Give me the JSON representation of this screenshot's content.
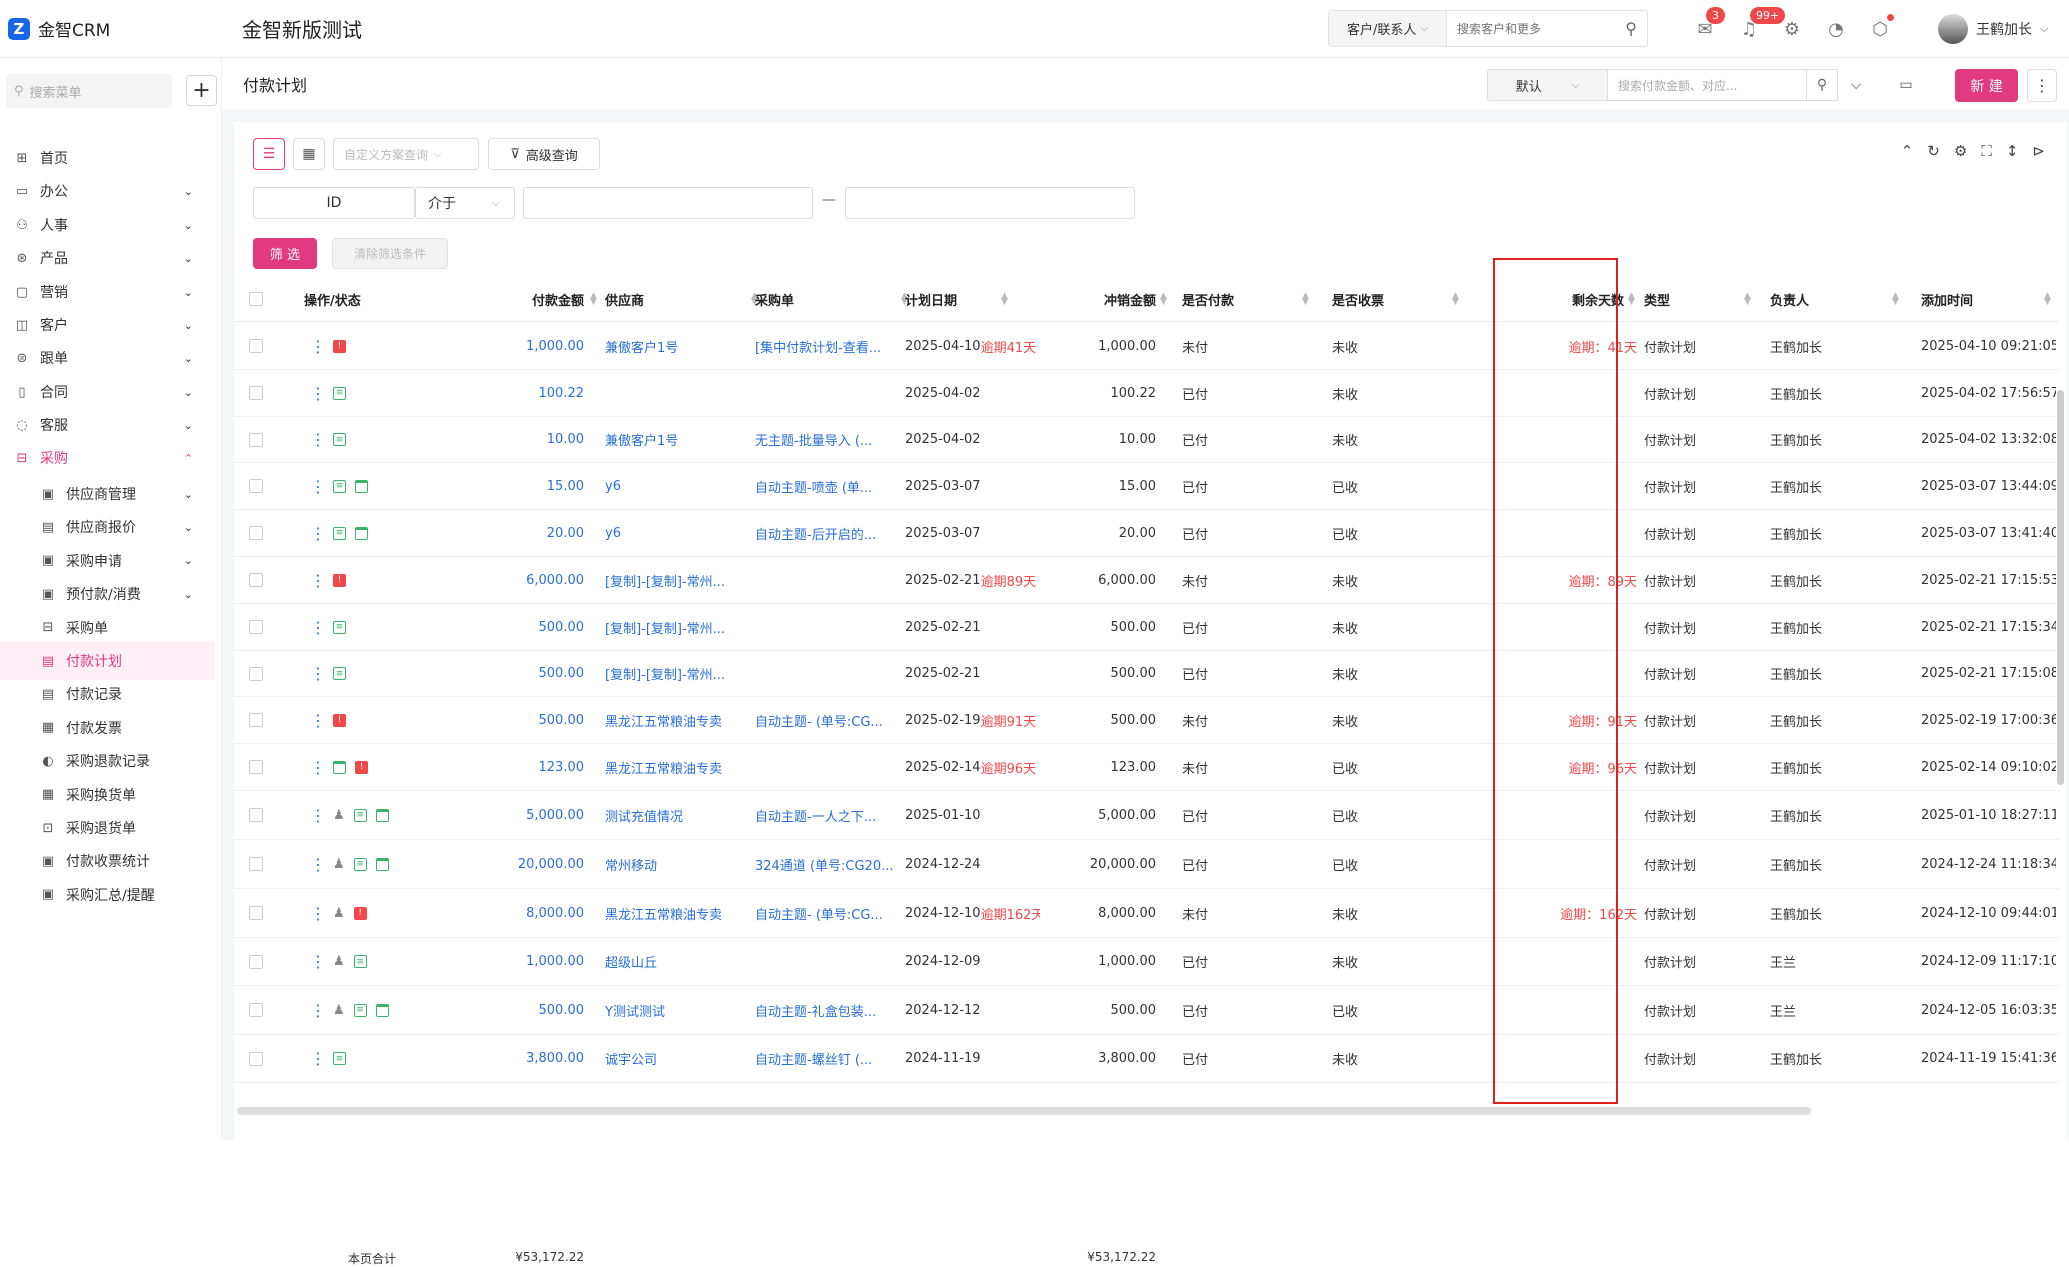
{
  "brand": {
    "name": "金智CRM",
    "logo_letter": "Z",
    "app_title": "金智新版测试"
  },
  "top_search": {
    "type": "客户/联系人",
    "placeholder": "搜索客户和更多"
  },
  "notifications": {
    "messages": "3",
    "alerts": "99+"
  },
  "user": {
    "name": "王鹤加长"
  },
  "sidebar": {
    "search_placeholder": "搜索菜单",
    "items": [
      {
        "label": "首页",
        "icon": "home-icon",
        "glyph": "⊞"
      },
      {
        "label": "办公",
        "icon": "office-icon",
        "glyph": "▭"
      },
      {
        "label": "人事",
        "icon": "people-icon",
        "glyph": "⚇"
      },
      {
        "label": "产品",
        "icon": "product-icon",
        "glyph": "⊛"
      },
      {
        "label": "营销",
        "icon": "marketing-icon",
        "glyph": "▢"
      },
      {
        "label": "客户",
        "icon": "customer-icon",
        "glyph": "◫"
      },
      {
        "label": "跟单",
        "icon": "follow-icon",
        "glyph": "⊜"
      },
      {
        "label": "合同",
        "icon": "contract-icon",
        "glyph": "▯"
      },
      {
        "label": "客服",
        "icon": "service-icon",
        "glyph": "◌"
      },
      {
        "label": "采购",
        "icon": "purchase-icon",
        "glyph": "⊟"
      }
    ],
    "sub_items": [
      {
        "label": "供应商管理",
        "expand": true
      },
      {
        "label": "供应商报价",
        "expand": true
      },
      {
        "label": "采购申请",
        "expand": true
      },
      {
        "label": "预付款/消费",
        "expand": true
      },
      {
        "label": "采购单",
        "expand": false
      },
      {
        "label": "付款计划",
        "expand": false
      },
      {
        "label": "付款记录",
        "expand": false
      },
      {
        "label": "付款发票",
        "expand": false
      },
      {
        "label": "采购退款记录",
        "expand": false
      },
      {
        "label": "采购换货单",
        "expand": false
      },
      {
        "label": "采购退货单",
        "expand": false
      },
      {
        "label": "付款收票统计",
        "expand": false
      },
      {
        "label": "采购汇总/提醒",
        "expand": false
      }
    ]
  },
  "page": {
    "title": "付款计划",
    "view": "默认",
    "search_placeholder": "搜索付款金额、对应...",
    "new_label": "新 建"
  },
  "toolbar": {
    "scheme_placeholder": "自定义方案查询",
    "advanced_label": "高级查询",
    "filter_field": "ID",
    "filter_op": "介于",
    "range_sep": "—",
    "filter_btn": "筛 选",
    "clear_btn": "清除筛选条件"
  },
  "table": {
    "headers": {
      "ops": "操作/状态",
      "amount": "付款金额",
      "supplier": "供应商",
      "po": "采购单",
      "plan_date": "计划日期",
      "offset": "冲销金额",
      "paid": "是否付款",
      "invoice": "是否收票",
      "days": "剩余天数",
      "type": "类型",
      "owner": "负责人",
      "added": "添加时间"
    },
    "rows": [
      {
        "icons": [
          "warn"
        ],
        "amount": "1,000.00",
        "supplier": "兼傲客户1号",
        "po": "[集中付款计划-查看...",
        "date": "2025-04-10",
        "overdue": "逾期41天",
        "offset": "1,000.00",
        "paid": "未付",
        "invoice": "未收",
        "days": "逾期：41天",
        "type": "付款计划",
        "owner": "王鹤加长",
        "added": "2025-04-10 09:21:05"
      },
      {
        "icons": [
          "doc"
        ],
        "amount": "100.22",
        "supplier": "",
        "po": "",
        "date": "2025-04-02",
        "overdue": "",
        "offset": "100.22",
        "paid": "已付",
        "invoice": "未收",
        "days": "",
        "type": "付款计划",
        "owner": "王鹤加长",
        "added": "2025-04-02 17:56:57"
      },
      {
        "icons": [
          "doc"
        ],
        "amount": "10.00",
        "supplier": "兼傲客户1号",
        "po": "无主题-批量导入 (...",
        "date": "2025-04-02",
        "overdue": "",
        "offset": "10.00",
        "paid": "已付",
        "invoice": "未收",
        "days": "",
        "type": "付款计划",
        "owner": "王鹤加长",
        "added": "2025-04-02 13:32:08"
      },
      {
        "icons": [
          "doc",
          "trash"
        ],
        "amount": "15.00",
        "supplier": "y6",
        "po": "自动主题-喷壶 (单...",
        "date": "2025-03-07",
        "overdue": "",
        "offset": "15.00",
        "paid": "已付",
        "invoice": "已收",
        "days": "",
        "type": "付款计划",
        "owner": "王鹤加长",
        "added": "2025-03-07 13:44:09"
      },
      {
        "icons": [
          "doc",
          "trash"
        ],
        "amount": "20.00",
        "supplier": "y6",
        "po": "自动主题-后开启的...",
        "date": "2025-03-07",
        "overdue": "",
        "offset": "20.00",
        "paid": "已付",
        "invoice": "已收",
        "days": "",
        "type": "付款计划",
        "owner": "王鹤加长",
        "added": "2025-03-07 13:41:40"
      },
      {
        "icons": [
          "warn"
        ],
        "amount": "6,000.00",
        "supplier": "[复制]-[复制]-常州...",
        "po": "",
        "date": "2025-02-21",
        "overdue": "逾期89天",
        "offset": "6,000.00",
        "paid": "未付",
        "invoice": "未收",
        "days": "逾期：89天",
        "type": "付款计划",
        "owner": "王鹤加长",
        "added": "2025-02-21 17:15:53"
      },
      {
        "icons": [
          "doc"
        ],
        "amount": "500.00",
        "supplier": "[复制]-[复制]-常州...",
        "po": "",
        "date": "2025-02-21",
        "overdue": "",
        "offset": "500.00",
        "paid": "已付",
        "invoice": "未收",
        "days": "",
        "type": "付款计划",
        "owner": "王鹤加长",
        "added": "2025-02-21 17:15:34"
      },
      {
        "icons": [
          "doc"
        ],
        "amount": "500.00",
        "supplier": "[复制]-[复制]-常州...",
        "po": "",
        "date": "2025-02-21",
        "overdue": "",
        "offset": "500.00",
        "paid": "已付",
        "invoice": "未收",
        "days": "",
        "type": "付款计划",
        "owner": "王鹤加长",
        "added": "2025-02-21 17:15:08"
      },
      {
        "icons": [
          "warn"
        ],
        "amount": "500.00",
        "supplier": "黑龙江五常粮油专卖",
        "po": "自动主题- (单号:CG...",
        "date": "2025-02-19",
        "overdue": "逾期91天",
        "offset": "500.00",
        "paid": "未付",
        "invoice": "未收",
        "days": "逾期：91天",
        "type": "付款计划",
        "owner": "王鹤加长",
        "added": "2025-02-19 17:00:36"
      },
      {
        "icons": [
          "trash",
          "warn"
        ],
        "amount": "123.00",
        "supplier": "黑龙江五常粮油专卖",
        "po": "",
        "date": "2025-02-14",
        "overdue": "逾期96天",
        "offset": "123.00",
        "paid": "未付",
        "invoice": "已收",
        "days": "逾期：96天",
        "type": "付款计划",
        "owner": "王鹤加长",
        "added": "2025-02-14 09:10:02"
      },
      {
        "icons": [
          "user",
          "doc",
          "trash"
        ],
        "amount": "5,000.00",
        "supplier": "测试充值情况",
        "po": "自动主题-一人之下...",
        "date": "2025-01-10",
        "overdue": "",
        "offset": "5,000.00",
        "paid": "已付",
        "invoice": "已收",
        "days": "",
        "type": "付款计划",
        "owner": "王鹤加长",
        "added": "2025-01-10 18:27:11"
      },
      {
        "icons": [
          "user",
          "doc",
          "trash"
        ],
        "amount": "20,000.00",
        "supplier": "常州移动",
        "po": "324通道 (单号:CG20...",
        "date": "2024-12-24",
        "overdue": "",
        "offset": "20,000.00",
        "paid": "已付",
        "invoice": "已收",
        "days": "",
        "type": "付款计划",
        "owner": "王鹤加长",
        "added": "2024-12-24 11:18:34"
      },
      {
        "icons": [
          "user",
          "warn"
        ],
        "amount": "8,000.00",
        "supplier": "黑龙江五常粮油专卖",
        "po": "自动主题- (单号:CG...",
        "date": "2024-12-10",
        "overdue": "逾期162天",
        "offset": "8,000.00",
        "paid": "未付",
        "invoice": "未收",
        "days": "逾期：162天",
        "type": "付款计划",
        "owner": "王鹤加长",
        "added": "2024-12-10 09:44:01"
      },
      {
        "icons": [
          "user",
          "doc"
        ],
        "amount": "1,000.00",
        "supplier": "超级山丘",
        "po": "",
        "date": "2024-12-09",
        "overdue": "",
        "offset": "1,000.00",
        "paid": "已付",
        "invoice": "未收",
        "days": "",
        "type": "付款计划",
        "owner": "王兰",
        "added": "2024-12-09 11:17:10"
      },
      {
        "icons": [
          "user",
          "doc",
          "trash"
        ],
        "amount": "500.00",
        "supplier": "Y测试测试",
        "po": "自动主题-礼盒包装...",
        "date": "2024-12-12",
        "overdue": "",
        "offset": "500.00",
        "paid": "已付",
        "invoice": "已收",
        "days": "",
        "type": "付款计划",
        "owner": "王兰",
        "added": "2024-12-05 16:03:35"
      },
      {
        "icons": [
          "doc"
        ],
        "amount": "3,800.00",
        "supplier": "诚宇公司",
        "po": "自动主题-螺丝钉 (...",
        "date": "2024-11-19",
        "overdue": "",
        "offset": "3,800.00",
        "paid": "已付",
        "invoice": "未收",
        "days": "",
        "type": "付款计划",
        "owner": "王鹤加长",
        "added": "2024-11-19 15:41:36"
      }
    ],
    "footer": {
      "label": "本页合计",
      "amount_total": "¥53,172.22",
      "offset_total": "¥53,172.22"
    }
  },
  "colors": {
    "accent": "#e23a7f",
    "link": "#2a6fd6",
    "danger": "#f04848",
    "highlight_box": "#e02020"
  }
}
